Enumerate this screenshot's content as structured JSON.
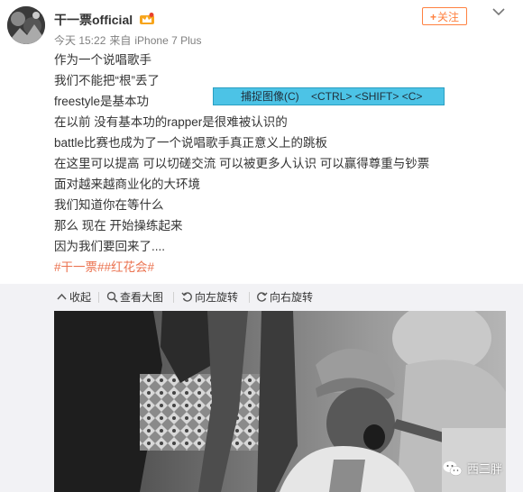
{
  "user": {
    "name": "干一票official",
    "avatar_icon": "avatar-photo",
    "badge_icon": "vip-crown-icon"
  },
  "meta": {
    "time": "今天 15:22",
    "source_prefix": "来自",
    "source": "iPhone 7 Plus"
  },
  "follow_button": {
    "plus": "+",
    "label": "关注"
  },
  "post": {
    "lines": [
      "作为一个说唱歌手",
      "我们不能把“根”丢了",
      "freestyle是基本功",
      "在以前 没有基本功的rapper是很难被认识的",
      "battle比赛也成为了一个说唱歌手真正意义上的跳板",
      "在这里可以提高 可以切磋交流 可以被更多人认识 可以赢得尊重与钞票",
      "面对越来越商业化的大环境",
      "我们知道你在等什么",
      "那么 现在 开始操练起来",
      "因为我们要回来了...."
    ],
    "tags": "#干一票##红花会#"
  },
  "overlay": {
    "text": "捕捉图像(C)    <CTRL> <SHIFT> <C>"
  },
  "toolbar": {
    "collapse": "收起",
    "view_large": "查看大图",
    "rotate_left": "向左旋转",
    "rotate_right": "向右旋转"
  },
  "watermark": {
    "text": "西三胖"
  },
  "colors": {
    "accent": "#eb7350",
    "follow": "#ff8140",
    "overlay": "#4cc3e6",
    "toolbar_bg": "#f2f2f5"
  }
}
